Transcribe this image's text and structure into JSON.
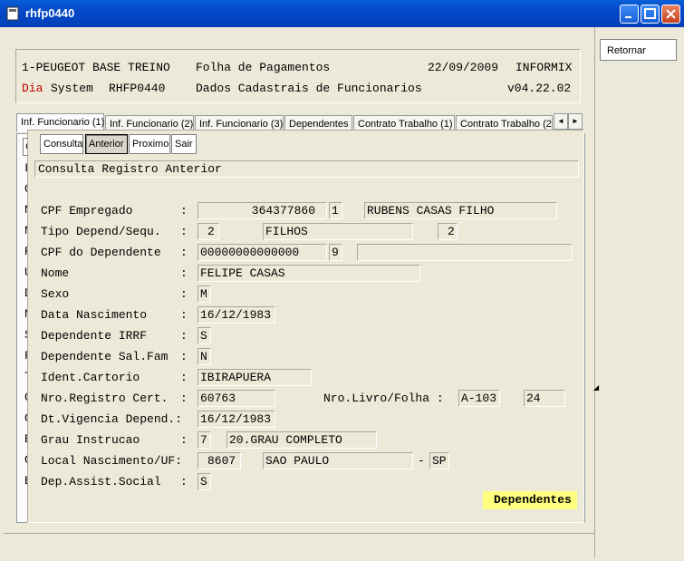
{
  "window": {
    "title": "rhfp0440"
  },
  "header": {
    "company": "1-PEUGEOT BASE TREINO",
    "module": "Folha de Pagamentos",
    "date": "22/09/2009",
    "db": "INFORMIX",
    "day_label": "Dia",
    "system": "System",
    "program": "RHFP0440",
    "screen_title": "Dados Cadastrais de Funcionarios",
    "version": "v04.22.02"
  },
  "side": {
    "retornar": "Retornar"
  },
  "tabs": [
    "Inf. Funcionario (1)",
    "Inf. Funcionario (2)",
    "Inf. Funcionario (3)",
    "Dependentes",
    "Contrato Trabalho (1)",
    "Contrato Trabalho (2)"
  ],
  "tab_arrows": {
    "left": "◄",
    "right": "►"
  },
  "underlay": {
    "button": "C",
    "letters": [
      "L",
      "C",
      "N",
      "N",
      "R",
      "U",
      "D",
      "N",
      "S",
      "F",
      "T",
      "C",
      "C",
      "E",
      "C",
      "B"
    ]
  },
  "toolbar": {
    "consulta": "Consulta",
    "anterior": "Anterior",
    "proximo": "Proximo",
    "sair": "Sair"
  },
  "message": "Consulta Registro Anterior",
  "labels": {
    "cpf_emp": "CPF Empregado",
    "tipo_dep": "Tipo Depend/Sequ.",
    "cpf_dep": "CPF do Dependente",
    "nome": "Nome",
    "sexo": "Sexo",
    "data_nasc": "Data Nascimento",
    "dep_irrf": "Dependente IRRF",
    "dep_salfam": "Dependente Sal.Fam",
    "ident_cart": "Ident.Cartorio",
    "nro_reg": "Nro.Registro Cert.",
    "nro_livro": "Nro.Livro/Folha :",
    "dt_vig": "Dt.Vigencia Depend.:",
    "grau": "Grau Instrucao",
    "local_nasc": "Local Nascimento/UF:",
    "dep_assist": "Dep.Assist.Social",
    "colon": ":",
    "dash": "-"
  },
  "values": {
    "cpf_emp": "364377860",
    "cpf_emp_dig": "1",
    "emp_name": "RUBENS CASAS FILHO",
    "tipo_dep": "2",
    "tipo_dep_desc": "FILHOS",
    "seq": "2",
    "cpf_dep": "00000000000000",
    "cpf_dep_dig": "9",
    "cpf_dep_extra": "",
    "nome": "FELIPE CASAS",
    "sexo": "M",
    "data_nasc": "16/12/1983",
    "dep_irrf": "S",
    "dep_salfam": "N",
    "ident_cart": "IBIRAPUERA",
    "nro_reg": "60763",
    "livro": "A-103",
    "folha": "24",
    "dt_vig": "16/12/1983",
    "grau": "7",
    "grau_desc": "20.GRAU COMPLETO",
    "local_cod": "8607",
    "local_nome": "SAO PAULO",
    "uf": "SP",
    "dep_assist": "S"
  },
  "status": "Dependentes"
}
